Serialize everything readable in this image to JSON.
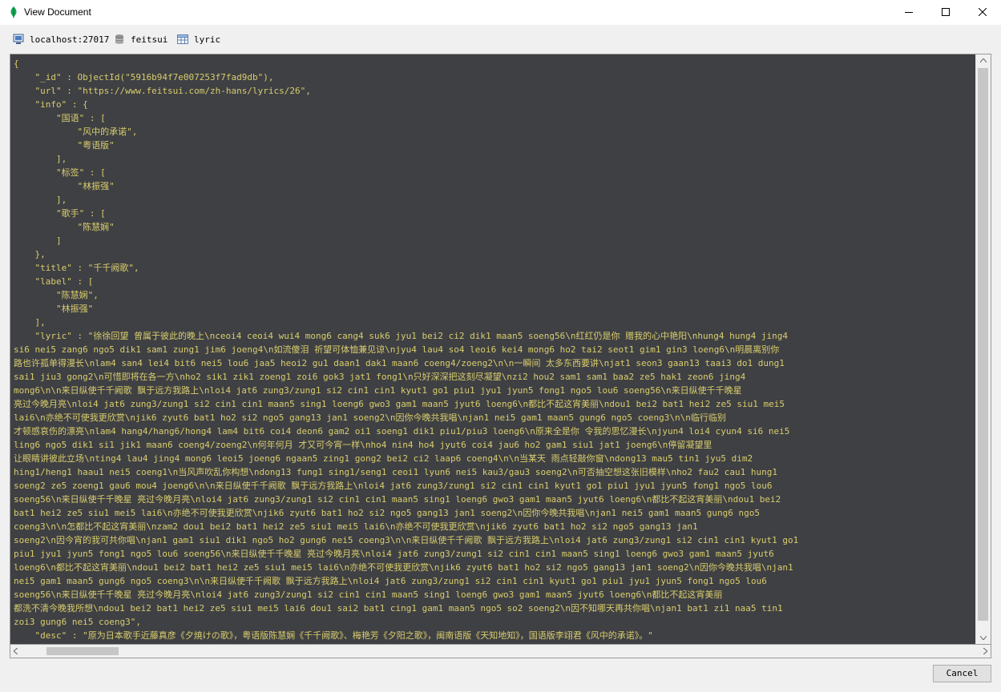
{
  "window": {
    "title": "View Document"
  },
  "breadcrumb": {
    "host": "localhost:27017",
    "database": "feitsui",
    "collection": "lyric"
  },
  "document_text": "{\n    \"_id\" : ObjectId(\"5916b94f7e007253f7fad9db\"),\n    \"url\" : \"https://www.feitsui.com/zh-hans/lyrics/26\",\n    \"info\" : {\n        \"国语\" : [\n            \"风中的承诺\",\n            \"粤语版\"\n        ],\n        \"标签\" : [\n            \"林振强\"\n        ],\n        \"歌手\" : [\n            \"陈慧娴\"\n        ]\n    },\n    \"title\" : \"千千阙歌\",\n    \"label\" : [\n        \"陈慧娴\",\n        \"林振强\"\n    ],\n    \"lyric\" : \"徐徐回望 曾属于彼此的晚上\\nceoi4 ceoi4 wui4 mong6 cang4 suk6 jyu1 bei2 ci2 dik1 maan5 soeng56\\n红红仍是你 赠我的心中艳阳\\nhung4 hung4 jing4\nsi6 nei5 zang6 ngo5 dik1 sam1 zung1 jim6 joeng4\\n如流傻泪 祈望可体恤兼见谅\\njyu4 lau4 so4 leoi6 kei4 mong6 ho2 tai2 seot1 gim1 gin3 loeng6\\n明晨离别你\n路也许孤单得漫长\\nlam4 san4 lei4 bit6 nei5 lou6 jaa5 heoi2 gu1 daan1 dak1 maan6 coeng4/zoeng2\\n\\n一瞬间 太多东西要讲\\njat1 seon3 gaan13 taai3 do1 dung1\nsai1 jiu3 gong2\\n可惜即将在各一方\\nho2 sik1 zik1 zoeng1 zoi6 gok3 jat1 fong1\\n只好深深把这刻尽凝望\\nzi2 hou2 sam1 sam1 baa2 ze5 hak1 zeon6 jing4\nmong6\\n\\n来日纵使千千阙歌 飘于远方我路上\\nloi4 jat6 zung3/zung1 si2 cin1 cin1 kyut1 go1 piu1 jyu1 jyun5 fong1 ngo5 lou6 soeng56\\n来日纵使千千晚星\n亮过今晚月亮\\nloi4 jat6 zung3/zung1 si2 cin1 cin1 maan5 sing1 loeng6 gwo3 gam1 maan5 jyut6 loeng6\\n都比不起这宵美丽\\ndou1 bei2 bat1 hei2 ze5 siu1 mei5\nlai6\\n亦绝不可使我更欣赏\\njik6 zyut6 bat1 ho2 si2 ngo5 gang13 jan1 soeng2\\n因你今晚共我唱\\njan1 nei5 gam1 maan5 gung6 ngo5 coeng3\\n\\n临行临别\n才顿感哀伤的漂亮\\nlam4 hang4/hang6/hong4 lam4 bit6 coi4 deon6 gam2 oi1 soeng1 dik1 piu1/piu3 loeng6\\n原来全是你 令我的思忆漫长\\njyun4 loi4 cyun4 si6 nei5\nling6 ngo5 dik1 si1 jik1 maan6 coeng4/zoeng2\\n何年何月 才又可今宵一样\\nho4 nin4 ho4 jyut6 coi4 jau6 ho2 gam1 siu1 jat1 joeng6\\n停留凝望里\n让眼睛讲彼此立场\\nting4 lau4 jing4 mong6 leoi5 joeng6 ngaan5 zing1 gong2 bei2 ci2 laap6 coeng4\\n\\n当某天 雨点轻敲你窗\\ndong13 mau5 tin1 jyu5 dim2\nhing1/heng1 haau1 nei5 coeng1\\n当风声吹乱你构想\\ndong13 fung1 sing1/seng1 ceoi1 lyun6 nei5 kau3/gau3 soeng2\\n可否抽空想这张旧模样\\nho2 fau2 cau1 hung1\nsoeng2 ze5 zoeng1 gau6 mou4 joeng6\\n\\n来日纵使千千阙歌 飘于远方我路上\\nloi4 jat6 zung3/zung1 si2 cin1 cin1 kyut1 go1 piu1 jyu1 jyun5 fong1 ngo5 lou6\nsoeng56\\n来日纵使千千晚星 亮过今晚月亮\\nloi4 jat6 zung3/zung1 si2 cin1 cin1 maan5 sing1 loeng6 gwo3 gam1 maan5 jyut6 loeng6\\n都比不起这宵美丽\\ndou1 bei2\nbat1 hei2 ze5 siu1 mei5 lai6\\n亦绝不可使我更欣赏\\njik6 zyut6 bat1 ho2 si2 ngo5 gang13 jan1 soeng2\\n因你今晚共我唱\\njan1 nei5 gam1 maan5 gung6 ngo5\ncoeng3\\n\\n怎都比不起这宵美丽\\nzam2 dou1 bei2 bat1 hei2 ze5 siu1 mei5 lai6\\n亦绝不可使我更欣赏\\njik6 zyut6 bat1 ho2 si2 ngo5 gang13 jan1\nsoeng2\\n因今宵的我可共你唱\\njan1 gam1 siu1 dik1 ngo5 ho2 gung6 nei5 coeng3\\n\\n来日纵使千千阙歌 飘于远方我路上\\nloi4 jat6 zung3/zung1 si2 cin1 cin1 kyut1 go1\npiu1 jyu1 jyun5 fong1 ngo5 lou6 soeng56\\n来日纵使千千晚星 亮过今晚月亮\\nloi4 jat6 zung3/zung1 si2 cin1 cin1 maan5 sing1 loeng6 gwo3 gam1 maan5 jyut6\nloeng6\\n都比不起这宵美丽\\ndou1 bei2 bat1 hei2 ze5 siu1 mei5 lai6\\n亦绝不可使我更欣赏\\njik6 zyut6 bat1 ho2 si2 ngo5 gang13 jan1 soeng2\\n因你今晚共我唱\\njan1\nnei5 gam1 maan5 gung6 ngo5 coeng3\\n\\n来日纵使千千阙歌 飘于远方我路上\\nloi4 jat6 zung3/zung1 si2 cin1 cin1 kyut1 go1 piu1 jyu1 jyun5 fong1 ngo5 lou6\nsoeng56\\n来日纵使千千晚星 亮过今晚月亮\\nloi4 jat6 zung3/zung1 si2 cin1 cin1 maan5 sing1 loeng6 gwo3 gam1 maan5 jyut6 loeng6\\n都比不起这宵美丽\n都洗不清今晚我所想\\ndou1 bei2 bat1 hei2 ze5 siu1 mei5 lai6 dou1 sai2 bat1 cing1 gam1 maan5 ngo5 so2 soeng2\\n因不知哪天再共你唱\\njan1 bat1 zi1 naa5 tin1\nzoi3 gung6 nei5 coeng3\",\n    \"desc\" : \"原为日本歌手近藤真彦《夕焼けの歌》，粤语版陈慧娴《千千阙歌》、梅艳芳《夕阳之歌》，闽南语版《天知地知》，国语版李翊君《风中的承诺》。\"",
  "buttons": {
    "cancel": "Cancel"
  }
}
